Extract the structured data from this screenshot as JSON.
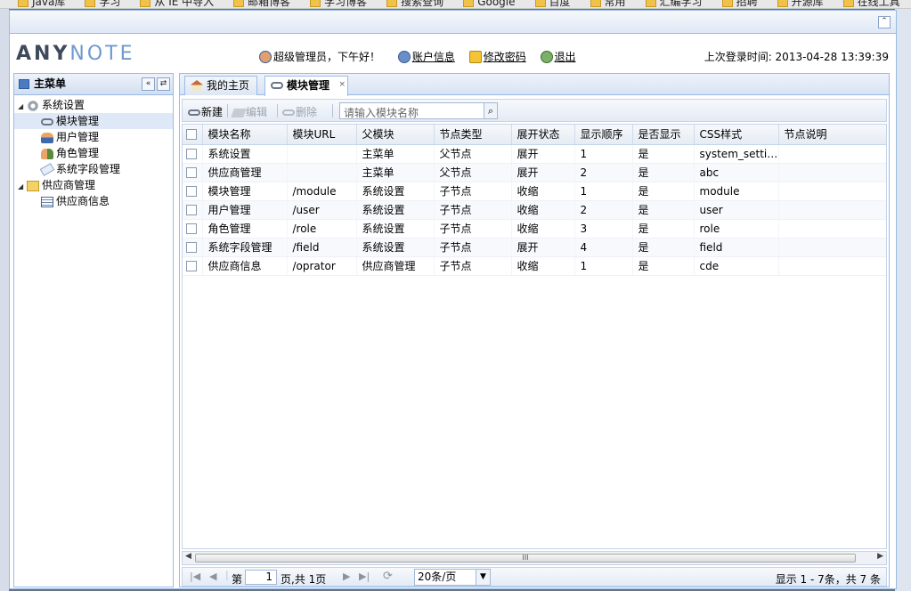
{
  "bookmarks": [
    "Java库",
    "学习",
    "从 IE 中导入",
    "邮箱博客",
    "学习博客",
    "搜索查询",
    "Google",
    "百度",
    "常用",
    "汇编学习",
    "招聘",
    "开源库",
    "在线工具"
  ],
  "app": {
    "logo_part1": "ANY",
    "logo_part2": "NOTE",
    "greeting": "超级管理员，下午好！",
    "account_link": "账户信息",
    "password_link": "修改密码",
    "logout_link": "退出",
    "last_login": "上次登录时间: 2013-04-28 13:39:39"
  },
  "menu": {
    "title": "主菜单",
    "collapse_glyph": "«",
    "refresh_glyph": "⇄",
    "items": [
      {
        "label": "系统设置",
        "level": 0
      },
      {
        "label": "模块管理",
        "level": 1
      },
      {
        "label": "用户管理",
        "level": 1
      },
      {
        "label": "角色管理",
        "level": 1
      },
      {
        "label": "系统字段管理",
        "level": 1
      },
      {
        "label": "供应商管理",
        "level": 0
      },
      {
        "label": "供应商信息",
        "level": 1
      }
    ]
  },
  "tabs": {
    "home": "我的主页",
    "module": "模块管理",
    "close_glyph": "×"
  },
  "toolbar": {
    "new_label": "新建",
    "edit_label": "编辑",
    "delete_label": "删除",
    "search_placeholder": "请输入模块名称",
    "search_glyph": "⌕"
  },
  "grid": {
    "columns": [
      "模块名称",
      "模块URL",
      "父模块",
      "节点类型",
      "展开状态",
      "显示顺序",
      "是否显示",
      "CSS样式",
      "节点说明"
    ],
    "rows": [
      [
        "系统设置",
        "",
        "主菜单",
        "父节点",
        "展开",
        "1",
        "是",
        "system_setti…",
        ""
      ],
      [
        "供应商管理",
        "",
        "主菜单",
        "父节点",
        "展开",
        "2",
        "是",
        "abc",
        ""
      ],
      [
        "模块管理",
        "/module",
        "系统设置",
        "子节点",
        "收缩",
        "1",
        "是",
        "module",
        ""
      ],
      [
        "用户管理",
        "/user",
        "系统设置",
        "子节点",
        "收缩",
        "2",
        "是",
        "user",
        ""
      ],
      [
        "角色管理",
        "/role",
        "系统设置",
        "子节点",
        "收缩",
        "3",
        "是",
        "role",
        ""
      ],
      [
        "系统字段管理",
        "/field",
        "系统设置",
        "子节点",
        "展开",
        "4",
        "是",
        "field",
        ""
      ],
      [
        "供应商信息",
        "/oprator",
        "供应商管理",
        "子节点",
        "收缩",
        "1",
        "是",
        "cde",
        ""
      ]
    ]
  },
  "pager": {
    "page_prefix": "第",
    "page_value": "1",
    "page_suffix": "页,共 1页",
    "page_size": "20条/页",
    "summary": "显示 1 - 7条，共 7 条",
    "scroll_grip": "III"
  }
}
